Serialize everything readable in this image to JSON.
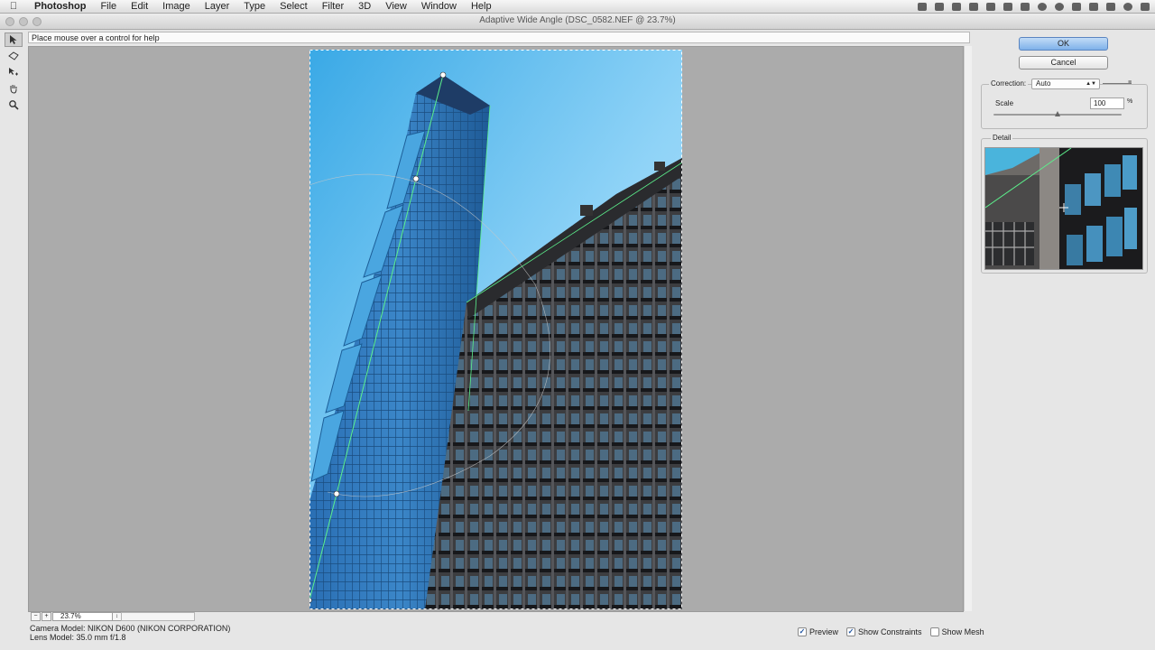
{
  "menubar": {
    "app": "Photoshop",
    "items": [
      "File",
      "Edit",
      "Image",
      "Layer",
      "Type",
      "Select",
      "Filter",
      "3D",
      "View",
      "Window",
      "Help"
    ]
  },
  "window": {
    "title": "Adaptive Wide Angle (DSC_0582.NEF @ 23.7%)"
  },
  "help_text": "Place mouse over a control for help",
  "tools": [
    {
      "icon": "constraint-tool-icon",
      "active": true
    },
    {
      "icon": "polygon-constraint-tool-icon",
      "active": false
    },
    {
      "icon": "move-tool-icon",
      "active": false
    },
    {
      "icon": "hand-tool-icon",
      "active": false
    },
    {
      "icon": "zoom-tool-icon",
      "active": false
    }
  ],
  "buttons": {
    "ok": "OK",
    "cancel": "Cancel"
  },
  "correction": {
    "label": "Correction:",
    "value": "Auto"
  },
  "scale": {
    "label": "Scale",
    "value": "100",
    "unit": "%"
  },
  "detail": {
    "label": "Detail"
  },
  "zoom": {
    "value": "23.7%",
    "minus": "−",
    "plus": "+"
  },
  "camera": {
    "model": "Camera Model: NIKON D600 (NIKON CORPORATION)",
    "lens": "Lens Model: 35.0 mm f/1.8"
  },
  "checkboxes": [
    {
      "label": "Preview",
      "checked": true
    },
    {
      "label": "Show Constraints",
      "checked": true
    },
    {
      "label": "Show Mesh",
      "checked": false
    }
  ],
  "colors": {
    "accent": "#7fb1ea",
    "constraint": "#5cf08c",
    "sky": "#6ec3ee"
  }
}
